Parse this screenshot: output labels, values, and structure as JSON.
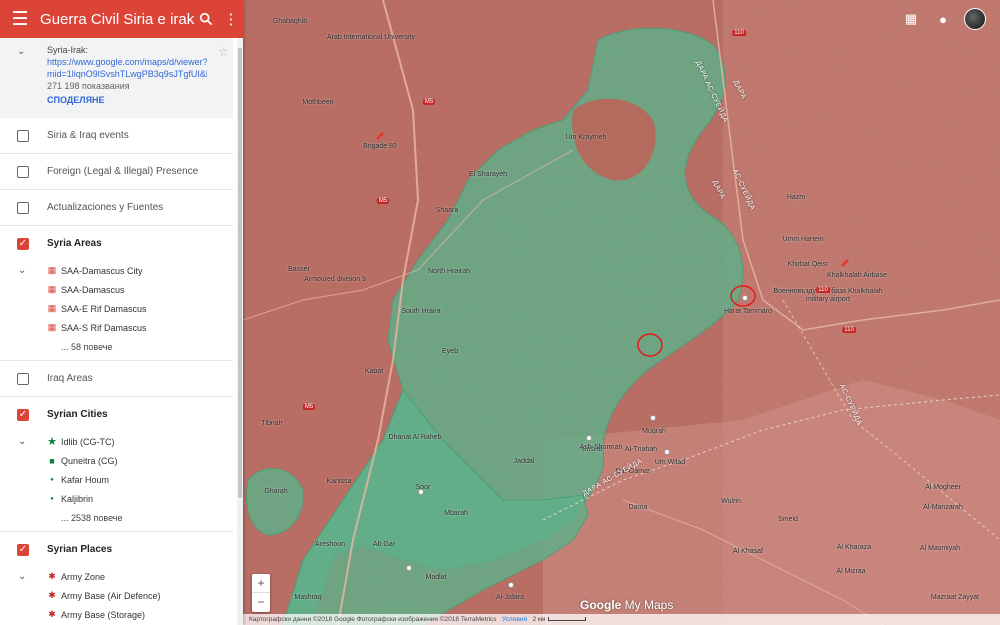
{
  "header": {
    "title": "Guerra Civil Siria e irak",
    "menu_icon": "menu-icon",
    "search_icon": "search-icon",
    "more_icon": "more-vert-icon"
  },
  "info": {
    "title": "Syria-Irak:",
    "url_line1": "https://www.google.com/maps/d/viewer?",
    "url_line2": "mid=1liqnO9lSvshTLwgPB3q9sJTgfUI&ll=3",
    "views": "271 198 показвания",
    "share": "СПОДЕЛЯНЕ"
  },
  "layers": [
    {
      "name": "Siria & Iraq events",
      "checked": false
    },
    {
      "name": "Foreign (Legal & Illegal) Presence",
      "checked": false
    },
    {
      "name": "Actualizaciones y Fuentes",
      "checked": false
    },
    {
      "name": "Syria Areas",
      "checked": true,
      "items": [
        "SAA-Damascus City",
        "SAA-Damascus",
        "SAA-E Rif Damascus",
        "SAA-S Rif Damascus"
      ],
      "more": "... 58 повече"
    },
    {
      "name": "Iraq Areas",
      "checked": false
    },
    {
      "name": "Syrian Cities",
      "checked": true,
      "items": [
        "Idlib (CG-TC)",
        "Quneitra (CG)",
        "Kafar Houm",
        "Kaljibrin"
      ],
      "more": "... 2538 повече"
    },
    {
      "name": "Syrian Places",
      "checked": true,
      "items": [
        "Army Zone",
        "Army Base (Air Defence)",
        "Army Base (Storage)"
      ]
    }
  ],
  "colors": {
    "header_red": "#db4437",
    "regime_red": "#b4645a",
    "rebel_green": "#5fb08a",
    "link_blue": "#3367d6"
  },
  "map": {
    "labels": [
      "Ghabaghib",
      "Arab International University",
      "Mothbeen",
      "Brigade 89",
      "El Sharayeh",
      "Shaara",
      "Um Kraymeh",
      "Hazm",
      "Umm Hartein",
      "Khirbat Qeisr",
      "Khalkhalah Airbase",
      "Военновъздушна база Khalkhalah military airport",
      "Basser",
      "Armoured division 9",
      "North Hrairah",
      "South Hraira",
      "Harat Tammaro",
      "Eyeb",
      "Kabat",
      "Tibnah",
      "Dhanat Al Raheb",
      "Muqrah",
      "Um Wilad",
      "Busrat",
      "Al-Tnahah",
      "Dar Gamar",
      "Jaddal",
      "Kanissa",
      "Soor",
      "Mbarah",
      "Areshoun",
      "Ab Gar",
      "Ash-Shomrah",
      "Dama",
      "Wulrin",
      "Smeid",
      "Al Khasaf",
      "Al Kharaza",
      "Al Mizraa",
      "Al-Manzarah",
      "Mazraat Zayyat",
      "Gharah",
      "Al Masmiyah",
      "Al-Jafara",
      "Madlat",
      "Mashraq",
      "Al Mogheer"
    ],
    "road_labels": [
      "M5",
      "M5",
      "M5",
      "110",
      "110",
      "110"
    ],
    "road_text": [
      "ДАРА",
      "АС-СУЕЙДА",
      "ДАРА",
      "АС-СУЕЙДА",
      "ДАРА АС-СУЕЙДА",
      "ДАРА АС-СУЕЙДА"
    ],
    "zoom_in": "+",
    "zoom_out": "−",
    "logo_google": "Google",
    "logo_mymaps": " My Maps",
    "attribution": "Картографски данни ©2018 Google Фотографски изображения ©2018 TerraMetrics",
    "terms": "Условия",
    "scale": "2 км"
  }
}
